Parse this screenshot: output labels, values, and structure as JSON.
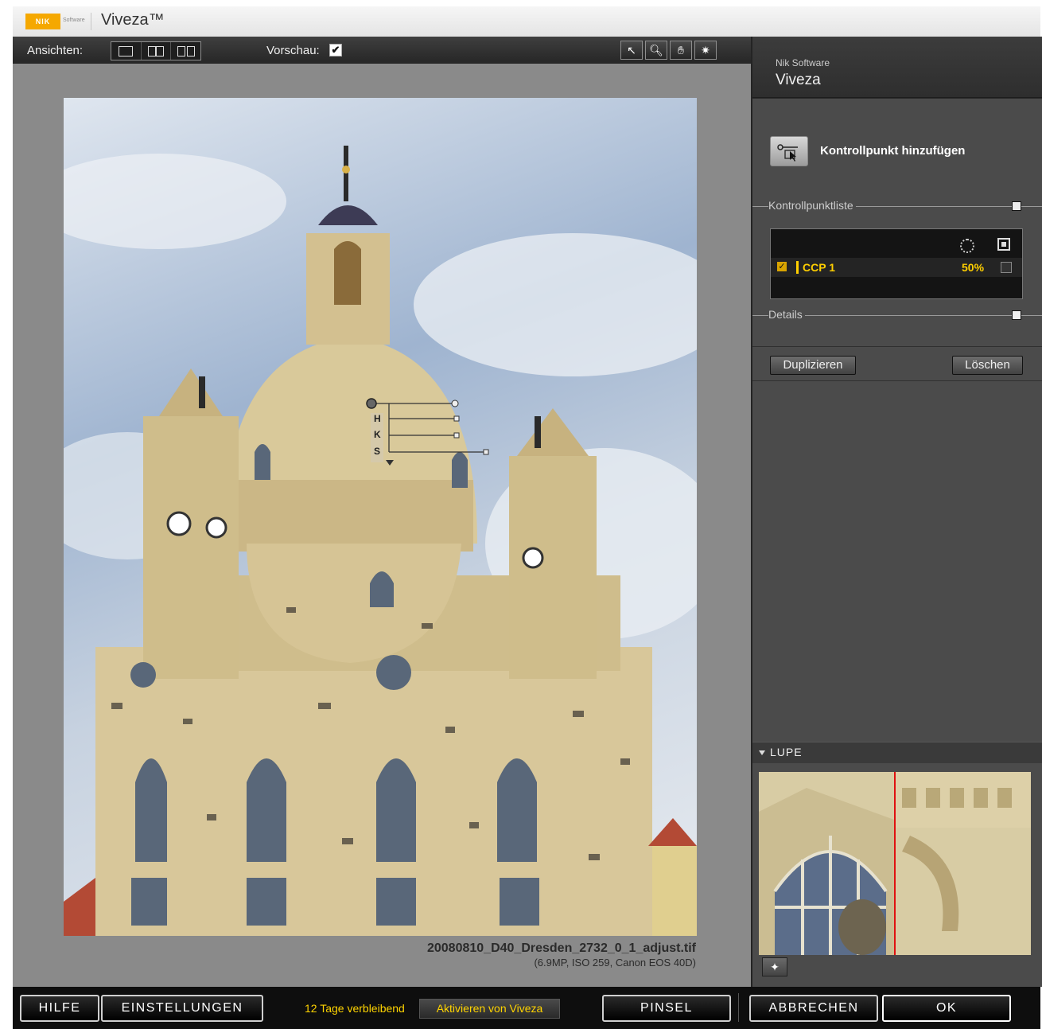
{
  "app": {
    "logo_text": "NIK",
    "logo_sub": "Software",
    "title": "Viveza™"
  },
  "toolbar": {
    "views_label": "Ansichten:",
    "preview_label": "Vorschau:",
    "preview_checked": "✔",
    "tools": [
      "pointer-icon",
      "zoom-icon",
      "hand-icon",
      "control-point-icon"
    ]
  },
  "image": {
    "filename": "20080810_D40_Dresden_2732_0_1_adjust.tif",
    "info": "(6.9MP, ISO 259, Canon EOS 40D)",
    "control_point_letters": [
      "H",
      "K",
      "S"
    ]
  },
  "panel": {
    "brand": "Nik Software",
    "product": "Viveza",
    "add_control_point": "Kontrollpunkt hinzufügen",
    "control_point_list_label": "Kontrollpunktliste",
    "details_label": "Details",
    "control_points": [
      {
        "name": "CCP 1",
        "opacity": "50%",
        "checked": "✓"
      }
    ],
    "duplicate": "Duplizieren",
    "delete": "Löschen",
    "loupe_label": "LUPE"
  },
  "bottom": {
    "help": "HILFE",
    "settings": "EINSTELLUNGEN",
    "trial": "12 Tage verbleibend",
    "activate": "Aktivieren von Viveza",
    "brush": "PINSEL",
    "cancel": "ABBRECHEN",
    "ok": "OK"
  },
  "colors": {
    "accent": "#ffd400",
    "brand": "#f5a800",
    "panel": "#4b4b4b"
  }
}
